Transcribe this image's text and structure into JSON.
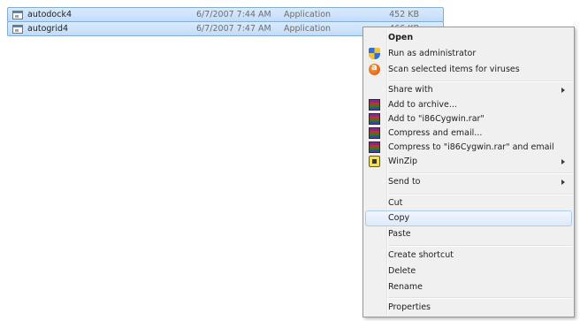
{
  "files": [
    {
      "name": "autodock4",
      "date": "6/7/2007 7:44 AM",
      "type": "Application",
      "size": "452 KB"
    },
    {
      "name": "autogrid4",
      "date": "6/7/2007 7:47 AM",
      "type": "Application",
      "size": "466 KB"
    }
  ],
  "context_menu": {
    "open": "Open",
    "run_as_admin": "Run as administrator",
    "scan_viruses": "Scan selected items for viruses",
    "share_with": "Share with",
    "add_to_archive": "Add to archive...",
    "add_to_rar": "Add to \"i86Cygwin.rar\"",
    "compress_email": "Compress and email...",
    "compress_rar_email": "Compress to \"i86Cygwin.rar\" and email",
    "winzip": "WinZip",
    "send_to": "Send to",
    "cut": "Cut",
    "copy": "Copy",
    "paste": "Paste",
    "create_shortcut": "Create shortcut",
    "delete": "Delete",
    "rename": "Rename",
    "properties": "Properties"
  },
  "icons": {
    "file": "application-file-icon",
    "admin": "uac-shield-icon",
    "antivirus": "avast-icon",
    "archive": "winrar-icon",
    "winzip": "winzip-icon"
  },
  "colors": {
    "selection": "#c1dbfc",
    "hover": "#dde9f9",
    "menu_bg": "#f0f0f0"
  }
}
